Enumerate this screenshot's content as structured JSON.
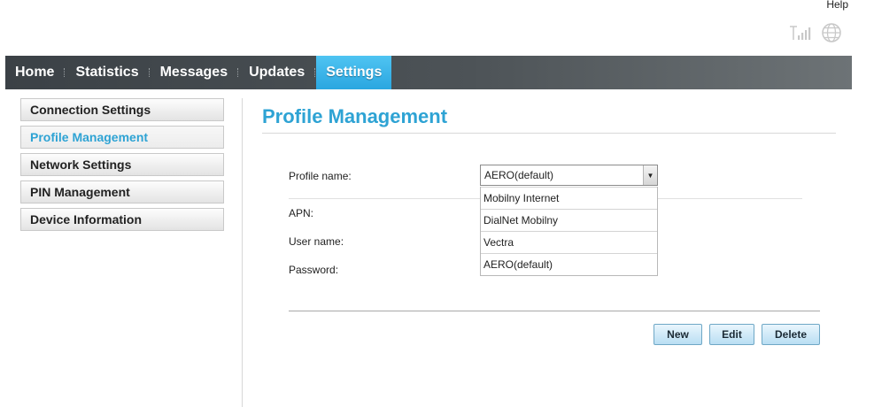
{
  "header": {
    "help_label": "Help"
  },
  "icons": {
    "signal": "signal-strength-icon",
    "globe": "globe-icon"
  },
  "nav": {
    "items": [
      {
        "label": "Home"
      },
      {
        "label": "Statistics"
      },
      {
        "label": "Messages"
      },
      {
        "label": "Updates"
      },
      {
        "label": "Settings",
        "active": true
      }
    ]
  },
  "sidebar": {
    "items": [
      {
        "label": "Connection Settings"
      },
      {
        "label": "Profile Management",
        "active": true
      },
      {
        "label": "Network Settings"
      },
      {
        "label": "PIN Management"
      },
      {
        "label": "Device Information"
      }
    ]
  },
  "main": {
    "title": "Profile Management",
    "form": {
      "profile_name_label": "Profile name:",
      "apn_label": "APN:",
      "user_name_label": "User name:",
      "password_label": "Password:",
      "profile_selected": "AERO(default)",
      "profile_options": [
        "Mobilny Internet",
        "DialNet Mobilny",
        "Vectra",
        "AERO(default)"
      ]
    },
    "buttons": {
      "new": "New",
      "edit": "Edit",
      "delete": "Delete"
    }
  },
  "colors": {
    "accent": "#2ea3d4",
    "nav_active": "#2aa6e0",
    "nav_bg": "#4d5357"
  }
}
